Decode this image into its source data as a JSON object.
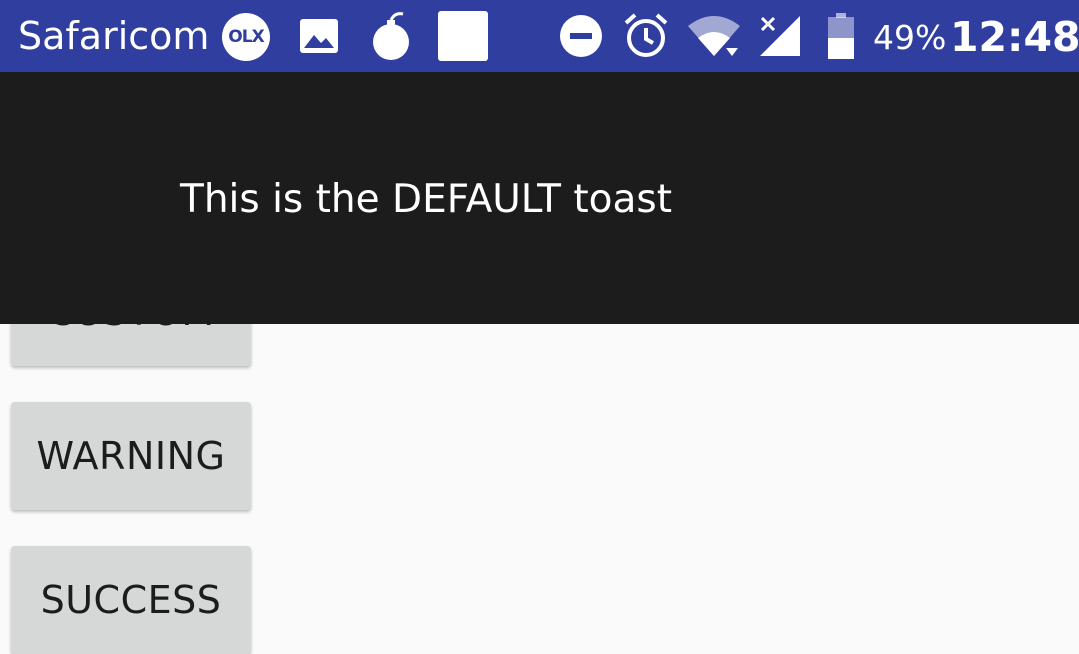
{
  "status_bar": {
    "carrier": "Safaricom",
    "olx_label": "OLX",
    "battery_percent": "49%",
    "time": "12:48",
    "icons": [
      "olx-icon",
      "image-icon",
      "bomb-icon",
      "blank-square-icon",
      "do-not-disturb-icon",
      "alarm-icon",
      "wifi-icon",
      "signal-icon",
      "battery-icon"
    ]
  },
  "buttons": {
    "custom": "CUSTOM",
    "warning": "WARNING",
    "success": "SUCCESS"
  },
  "toast": {
    "message": "This is the DEFAULT toast"
  },
  "colors": {
    "status_bar": "#303f9f",
    "toast_bg": "#1c1c1c",
    "button_bg": "#d6d7d7",
    "page_bg": "#fafafa"
  }
}
